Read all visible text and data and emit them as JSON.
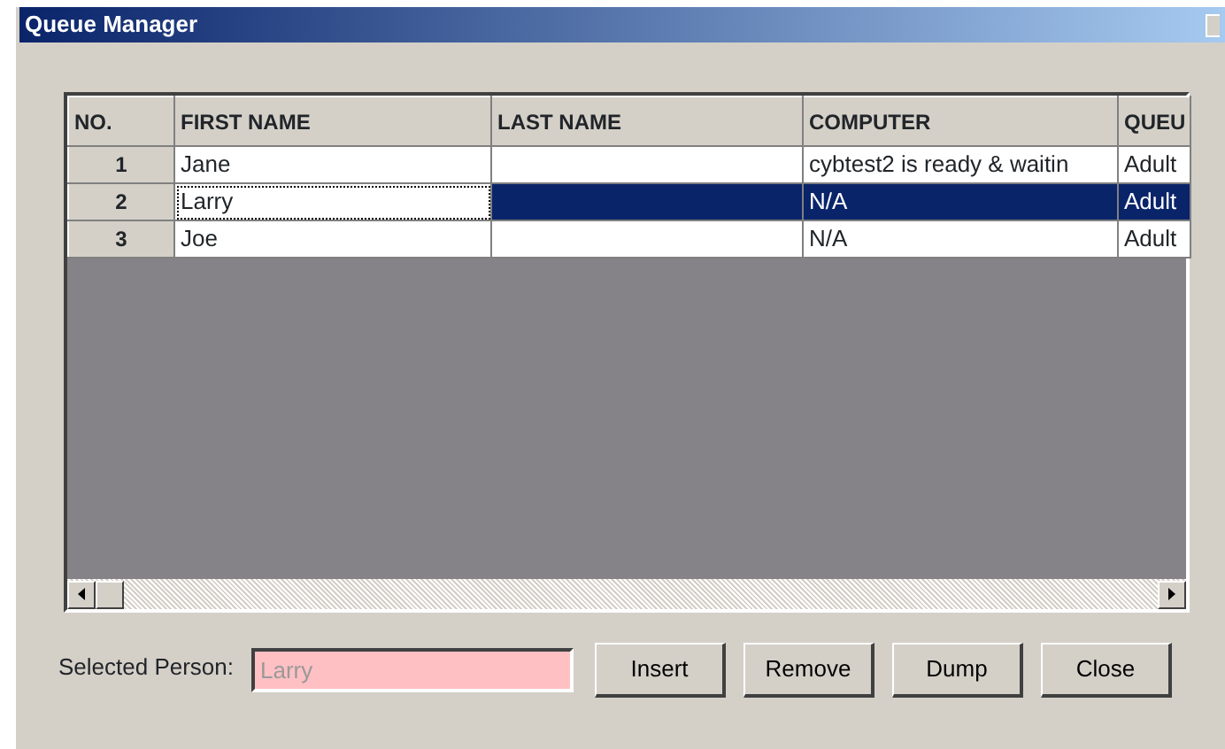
{
  "window": {
    "title": "Queue Manager"
  },
  "table": {
    "columns": [
      "NO.",
      "FIRST NAME",
      "LAST NAME",
      "COMPUTER",
      "QUEU"
    ],
    "rows": [
      {
        "cells": [
          "1",
          "Jane",
          "",
          "cybtest2 is ready & waitin",
          "Adult"
        ],
        "selected": false
      },
      {
        "cells": [
          "2",
          "Larry",
          "",
          "N/A",
          "Adult"
        ],
        "selected": true
      },
      {
        "cells": [
          "3",
          "Joe",
          "",
          "N/A",
          "Adult"
        ],
        "selected": false
      }
    ]
  },
  "selected_person": {
    "label": "Selected Person:",
    "value": "Larry",
    "disabled": true
  },
  "buttons": [
    "Insert",
    "Remove",
    "Dump",
    "Close"
  ]
}
